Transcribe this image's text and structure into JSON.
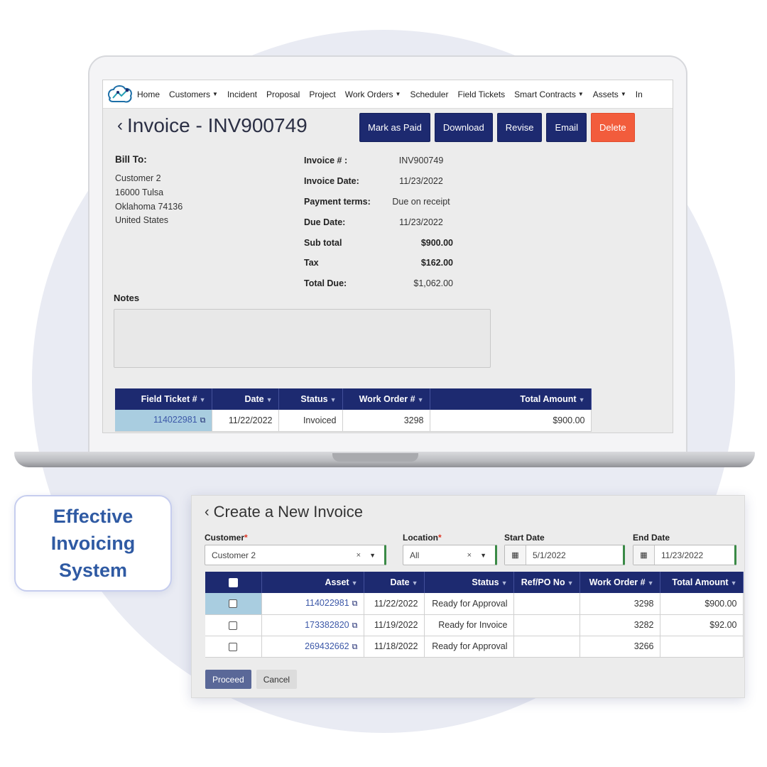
{
  "badge": {
    "line1": "Effective",
    "line2": "Invoicing",
    "line3": "System"
  },
  "nav": {
    "items": [
      {
        "label": "Home",
        "caret": false
      },
      {
        "label": "Customers",
        "caret": true
      },
      {
        "label": "Incident",
        "caret": false
      },
      {
        "label": "Proposal",
        "caret": false
      },
      {
        "label": "Project",
        "caret": false
      },
      {
        "label": "Work Orders",
        "caret": true
      },
      {
        "label": "Scheduler",
        "caret": false
      },
      {
        "label": "Field Tickets",
        "caret": false
      },
      {
        "label": "Smart Contracts",
        "caret": true
      },
      {
        "label": "Assets",
        "caret": true
      },
      {
        "label": "In",
        "caret": false
      }
    ]
  },
  "invoice": {
    "title": "Invoice - INV900749",
    "buttons": {
      "mark_paid": "Mark as Paid",
      "download": "Download",
      "revise": "Revise",
      "email": "Email",
      "delete": "Delete"
    },
    "bill_to": {
      "heading": "Bill To:",
      "name": "Customer 2",
      "street": "16000 Tulsa",
      "state": "Oklahoma 74136",
      "country": "United States"
    },
    "details": {
      "invoice_no_label": "Invoice # :",
      "invoice_no": "INV900749",
      "invoice_date_label": "Invoice Date:",
      "invoice_date": "11/23/2022",
      "payment_terms_label": "Payment terms:",
      "payment_terms": "Due on receipt",
      "due_date_label": "Due Date:",
      "due_date": "11/23/2022",
      "subtotal_label": "Sub total",
      "subtotal": "$900.00",
      "tax_label": "Tax",
      "tax": "$162.00",
      "total_label": "Total Due:",
      "total": "$1,062.00"
    },
    "notes_label": "Notes",
    "table": {
      "headers": [
        "Field Ticket #",
        "Date",
        "Status",
        "Work Order #",
        "Total Amount"
      ],
      "rows": [
        {
          "ticket": "114022981",
          "date": "11/22/2022",
          "status": "Invoiced",
          "work_order": "3298",
          "amount": "$900.00"
        }
      ]
    }
  },
  "create": {
    "title": "Create a New Invoice",
    "customer_label": "Customer",
    "customer_value": "Customer 2",
    "location_label": "Location",
    "location_value": "All",
    "start_label": "Start Date",
    "start_value": "5/1/2022",
    "end_label": "End Date",
    "end_value": "11/23/2022",
    "headers": [
      "Asset",
      "Date",
      "Status",
      "Ref/PO No",
      "Work Order #",
      "Total Amount"
    ],
    "rows": [
      {
        "asset": "114022981",
        "date": "11/22/2022",
        "status": "Ready for Approval",
        "ref": "",
        "work_order": "3298",
        "amount": "$900.00"
      },
      {
        "asset": "173382820",
        "date": "11/19/2022",
        "status": "Ready for Invoice",
        "ref": "",
        "work_order": "3282",
        "amount": "$92.00"
      },
      {
        "asset": "269432662",
        "date": "11/18/2022",
        "status": "Ready for Approval",
        "ref": "",
        "work_order": "3266",
        "amount": ""
      }
    ],
    "proceed": "Proceed",
    "cancel": "Cancel"
  }
}
